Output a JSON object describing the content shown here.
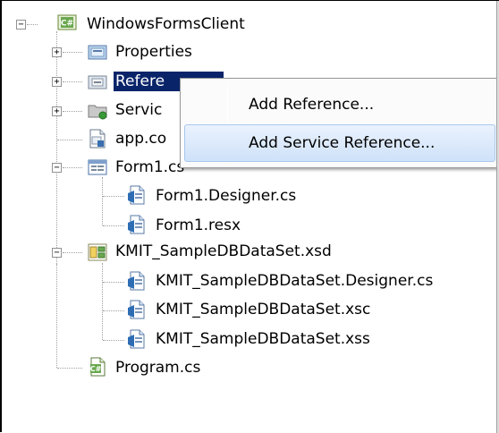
{
  "tree": {
    "root": {
      "label": "WindowsFormsClient",
      "icon": "csharp-project-icon",
      "expander": "−"
    },
    "items": [
      {
        "label": "Properties",
        "icon": "properties-folder-icon",
        "expander": "+"
      },
      {
        "label": "Refere",
        "icon": "references-folder-icon",
        "expander": "+",
        "selected": true
      },
      {
        "label": "Servic",
        "icon": "service-references-folder-icon",
        "expander": "+"
      },
      {
        "label": "app.co",
        "icon": "config-file-icon"
      },
      {
        "label": "Form1.cs",
        "icon": "form-icon",
        "expander": "−"
      },
      {
        "label": "Form1.Designer.cs",
        "icon": "cs-file-icon"
      },
      {
        "label": "Form1.resx",
        "icon": "cs-file-icon"
      },
      {
        "label": "KMIT_SampleDBDataSet.xsd",
        "icon": "dataset-icon",
        "expander": "−"
      },
      {
        "label": "KMIT_SampleDBDataSet.Designer.cs",
        "icon": "cs-file-icon"
      },
      {
        "label": "KMIT_SampleDBDataSet.xsc",
        "icon": "cs-file-icon"
      },
      {
        "label": "KMIT_SampleDBDataSet.xss",
        "icon": "cs-file-icon"
      },
      {
        "label": "Program.cs",
        "icon": "csharp-file-icon"
      }
    ]
  },
  "context_menu": {
    "items": [
      {
        "label": "Add Reference..."
      },
      {
        "label": "Add Service Reference...",
        "hover": true
      }
    ]
  },
  "colors": {
    "selection": "#0a246a",
    "menu_hover_top": "#eaf2fd",
    "menu_hover_bottom": "#cfe2f9"
  }
}
